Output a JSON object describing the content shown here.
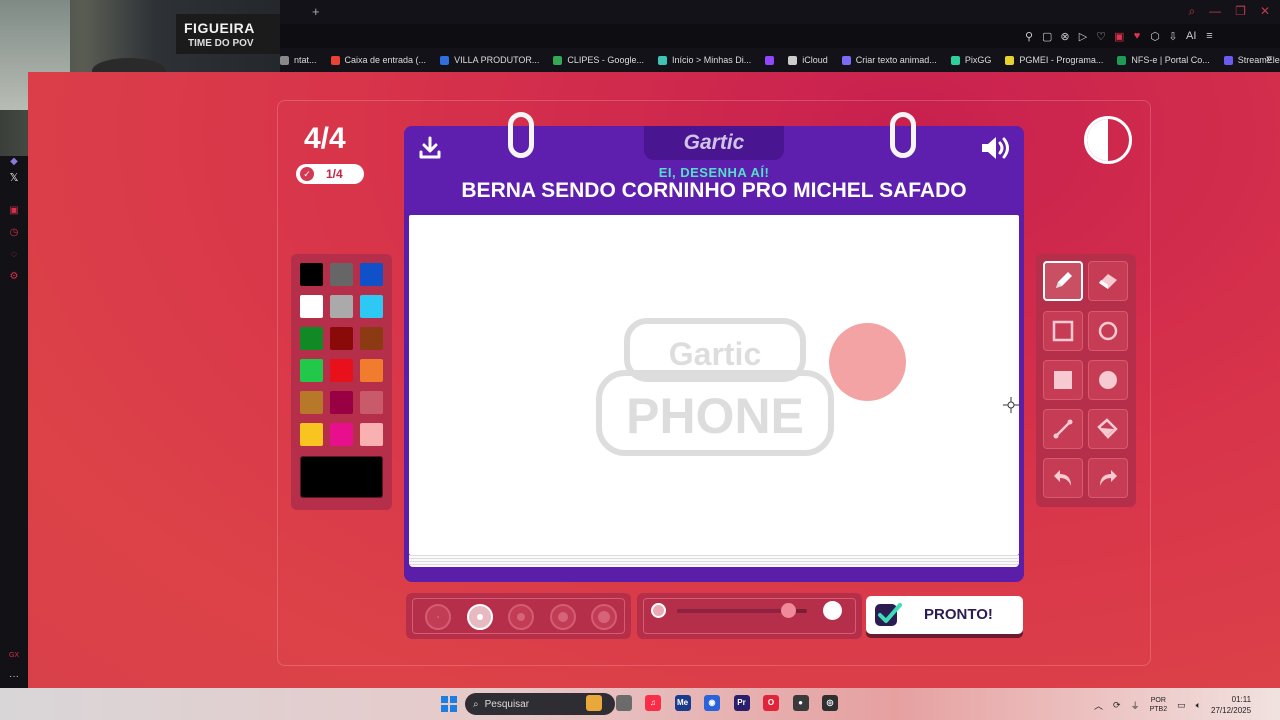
{
  "browser": {
    "new_tab": "+",
    "window_controls": [
      "⌕",
      "—",
      "❐",
      "✕"
    ],
    "toolbar_icons": [
      "⚲",
      "▢",
      "⊗",
      "▷",
      "♡",
      "▣",
      "♥",
      "⬡",
      "⇩",
      "≡"
    ],
    "ai_label": "AI",
    "bookmarks": [
      {
        "label": "ntat...",
        "color": "#888888"
      },
      {
        "label": "Caixa de entrada (...",
        "color": "#ea4335"
      },
      {
        "label": "VILLA PRODUTOR...",
        "color": "#2f6fe0"
      },
      {
        "label": "CLIPES - Google...",
        "color": "#34a853"
      },
      {
        "label": "Início > Minhas Di...",
        "color": "#3ec3b5"
      },
      {
        "label": "",
        "color": "#9146ff"
      },
      {
        "label": "iCloud",
        "color": "#cccccc"
      },
      {
        "label": "Criar texto animad...",
        "color": "#7a6cf5"
      },
      {
        "label": "PixGG",
        "color": "#2ecf9a"
      },
      {
        "label": "PGMEI - Programa...",
        "color": "#e6d22f"
      },
      {
        "label": "NFS-e | Portal Co...",
        "color": "#1f9a55"
      },
      {
        "label": "StreamElements -...",
        "color": "#6b5cf0"
      }
    ],
    "bookmarks_more": "»"
  },
  "webcam": {
    "poster_line1": "FIGUEIRA",
    "poster_line2": "TIME DO POV"
  },
  "sidebar": {
    "x_label": "𝕏",
    "bottom_label": "GX",
    "more": "···"
  },
  "game": {
    "round": "4/4",
    "votes": "1/4",
    "logo": "Gartic",
    "prompt_sub": "EI, DESENHA AÍ!",
    "prompt": "BERNA SENDO CORNINHO PRO MICHEL SAFADO",
    "watermark_top": "Gartic",
    "watermark_bottom": "PHONE",
    "palette": [
      "#000000",
      "#666666",
      "#1050c8",
      "#ffffff",
      "#aaaaaa",
      "#2ec8f4",
      "#118a26",
      "#8a0a0a",
      "#8b3a12",
      "#22c84a",
      "#e8101a",
      "#f27c2e",
      "#b8782a",
      "#990044",
      "#c85a6a",
      "#f8c420",
      "#e80f8c",
      "#f8b0b0"
    ],
    "current_color": "#000000",
    "drawn_shape_color": "#f4a3a5",
    "tools": [
      "pencil",
      "eraser",
      "rectangle-outline",
      "ellipse-outline",
      "rectangle-filled",
      "ellipse-filled",
      "line",
      "fill-bucket",
      "undo",
      "redo"
    ],
    "active_tool": "pencil",
    "brush_sizes": 5,
    "active_brush_size_index": 1,
    "opacity": 0.85,
    "done_label": "PRONTO!"
  },
  "taskbar": {
    "search_placeholder": "Pesquisar",
    "apps": [
      {
        "label": "",
        "color": "#e8a83a"
      },
      {
        "label": "",
        "color": "#6b6b6b"
      },
      {
        "label": "♫",
        "color": "#fa2d48"
      },
      {
        "label": "Me",
        "color": "#1b3c8c"
      },
      {
        "label": "◉",
        "color": "#2a64d8"
      },
      {
        "label": "Pr",
        "color": "#2a1f6b"
      },
      {
        "label": "O",
        "color": "#e0243a"
      },
      {
        "label": "●",
        "color": "#3a3a3a"
      },
      {
        "label": "◎",
        "color": "#2f2f2f"
      }
    ],
    "lang_top": "POR",
    "lang_bottom": "PTB2",
    "time": "01:11",
    "date": "27/12/2025"
  }
}
